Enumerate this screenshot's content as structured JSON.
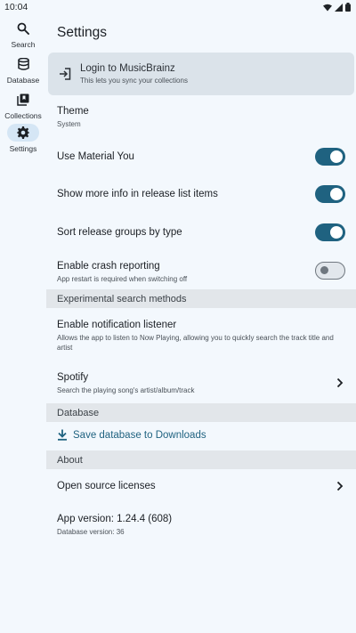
{
  "status_bar": {
    "time": "10:04"
  },
  "rail": {
    "items": [
      {
        "label": "Search"
      },
      {
        "label": "Database"
      },
      {
        "label": "Collections"
      },
      {
        "label": "Settings"
      }
    ]
  },
  "page": {
    "title": "Settings"
  },
  "login": {
    "title": "Login to MusicBrainz",
    "subtitle": "This lets you sync your collections"
  },
  "theme": {
    "title": "Theme",
    "value": "System"
  },
  "toggles": {
    "material_you": {
      "title": "Use Material You",
      "on": true
    },
    "more_info": {
      "title": "Show more info in release list items",
      "on": true
    },
    "sort_groups": {
      "title": "Sort release groups by type",
      "on": true
    },
    "crash_reporting": {
      "title": "Enable crash reporting",
      "subtitle": "App restart is required when switching off",
      "on": false
    }
  },
  "sections": {
    "experimental": "Experimental search methods",
    "database": "Database",
    "about": "About"
  },
  "notification_listener": {
    "title": "Enable notification listener",
    "subtitle": "Allows the app to listen to Now Playing, allowing you to quickly search the track title and artist"
  },
  "spotify": {
    "title": "Spotify",
    "subtitle": "Search the playing song's artist/album/track"
  },
  "save_db": {
    "label": "Save database to Downloads"
  },
  "licenses": {
    "title": "Open source licenses"
  },
  "version": {
    "title": "App version: 1.24.4 (608)",
    "db": "Database version: 36"
  },
  "colors": {
    "accent": "#1f6280",
    "background": "#f3f8fd",
    "section": "#e2e6ea",
    "card": "#dbe3ea"
  }
}
